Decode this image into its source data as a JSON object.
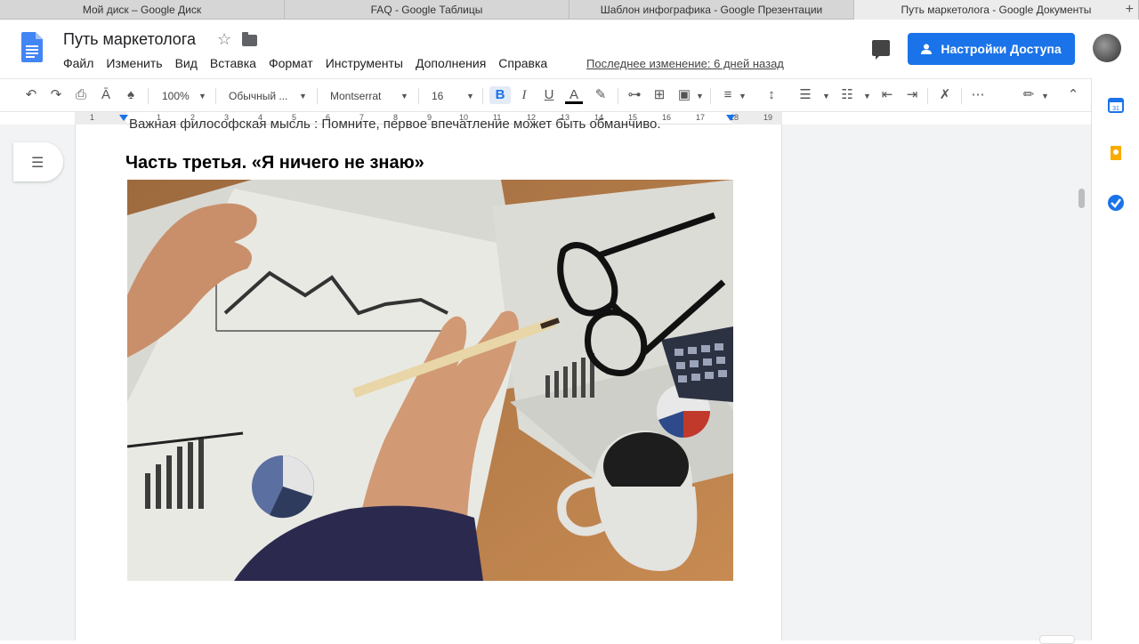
{
  "browser_tabs": [
    {
      "label": "Мой диск – Google Диск"
    },
    {
      "label": "FAQ - Google Таблицы"
    },
    {
      "label": "Шаблон инфографика - Google Презентации"
    },
    {
      "label": "Путь маркетолога - Google Документы"
    }
  ],
  "tab_plus": "+",
  "doc": {
    "title": "Путь маркетолога",
    "last_edit": "Последнее изменение: 6 дней назад",
    "share_label": "Настройки Доступа"
  },
  "menu": [
    "Файл",
    "Изменить",
    "Вид",
    "Вставка",
    "Формат",
    "Инструменты",
    "Дополнения",
    "Справка"
  ],
  "toolbar": {
    "zoom": "100%",
    "style": "Обычный ...",
    "font": "Montserrat",
    "size": "16",
    "bold": "B",
    "italic": "I",
    "underline": "U",
    "text_color": "A",
    "more": "⋯"
  },
  "ruler_numbers": [
    "1",
    "1",
    "2",
    "3",
    "4",
    "5",
    "6",
    "7",
    "8",
    "9",
    "10",
    "11",
    "12",
    "13",
    "14",
    "15",
    "16",
    "17",
    "18",
    "19"
  ],
  "content": {
    "cut_text": "Важная философская мысль : Помните, первое впечатление может быть обманчиво.",
    "heading": "Часть третья. «Я ничего не знаю»"
  },
  "colors": {
    "accent": "#1a73e8",
    "calendar": "#1a73e8",
    "keep": "#f9ab00",
    "tasks": "#1a73e8"
  }
}
